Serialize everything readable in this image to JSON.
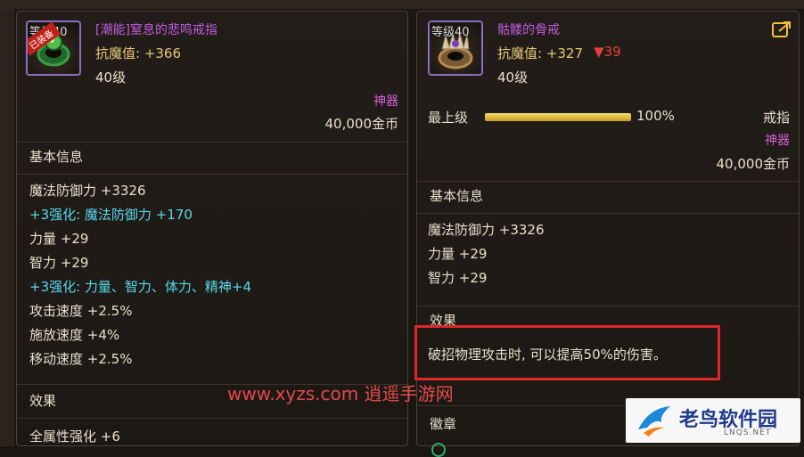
{
  "left_card": {
    "level_label": "等级40",
    "ribbon": "已装备",
    "item_name": "[潮能]窒息的悲鸣戒指",
    "magic_resist": "抗魔值: +366",
    "level": "40级",
    "rarity": "神器",
    "price": "40,000金币",
    "basic_info_title": "基本信息",
    "stats": [
      {
        "text": "魔法防御力 +3326",
        "color": "white"
      },
      {
        "text": "+3强化: 魔法防御力 +170",
        "color": "cyan"
      },
      {
        "text": "力量 +29",
        "color": "white"
      },
      {
        "text": "智力 +29",
        "color": "white"
      },
      {
        "text": "+3强化: 力量、智力、体力、精神+4",
        "color": "cyan"
      },
      {
        "text": "攻击速度 +2.5%",
        "color": "white"
      },
      {
        "text": "施放速度 +4%",
        "color": "white"
      },
      {
        "text": "移动速度 +2.5%",
        "color": "white"
      }
    ],
    "effect_title": "效果",
    "effect_line": "全属性强化 +6"
  },
  "right_card": {
    "level_label": "等级40",
    "item_name": "骷髅的骨戒",
    "magic_resist": "抗魔值: +327",
    "resist_diff": "▼39",
    "level": "40级",
    "upgrade_label": "最上级",
    "upgrade_percent_text": "100%",
    "upgrade_fraction": 1.0,
    "slot": "戒指",
    "rarity": "神器",
    "price": "40,000金币",
    "basic_info_title": "基本信息",
    "stats": [
      "魔法防御力 +3326",
      "力量 +29",
      "智力 +29"
    ],
    "effect_title": "效果",
    "effect_text": "破招物理攻击时, 可以提高50%的伤害。",
    "emblem_title": "徽章"
  },
  "watermark": "www.xyzs.com  逍遥手游网",
  "logo": {
    "main": "老鸟软件园",
    "sub": "LNQS.NET"
  },
  "colors": {
    "highlight": "#e1262a",
    "name": "#c35be0",
    "cyan": "#58d8ee",
    "gold": "#e8c77a"
  }
}
